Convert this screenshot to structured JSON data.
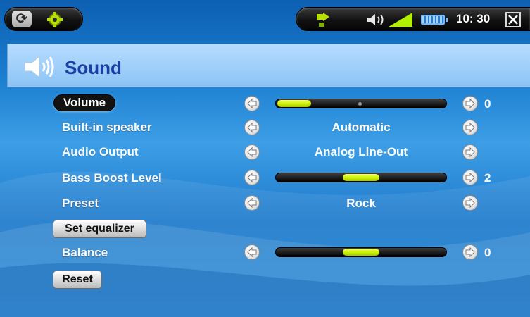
{
  "status_bar": {
    "time": "10: 30",
    "signal_color": "#b2f000",
    "icons": [
      "sync-icon",
      "settings-icon",
      "connection-icon",
      "speaker-icon",
      "signal-icon",
      "battery-icon",
      "close-icon"
    ]
  },
  "page": {
    "title": "Sound",
    "title_color": "#1a3da8"
  },
  "settings": {
    "volume": {
      "label": "Volume",
      "value": "0",
      "level": 0.0
    },
    "builtin_speaker": {
      "label": "Built-in speaker",
      "value": "Automatic"
    },
    "audio_output": {
      "label": "Audio Output",
      "value": "Analog Line-Out"
    },
    "bass_boost": {
      "label": "Bass Boost Level",
      "value": "2"
    },
    "preset": {
      "label": "Preset",
      "value": "Rock"
    },
    "balance": {
      "label": "Balance",
      "value": "0"
    }
  },
  "buttons": {
    "set_equalizer": "Set equalizer",
    "reset": "Reset"
  },
  "colors": {
    "accent_yellow_green": "#cdf000",
    "background_blue": "#1c7fd0",
    "title_bar_blue": "#8cc4f5"
  }
}
